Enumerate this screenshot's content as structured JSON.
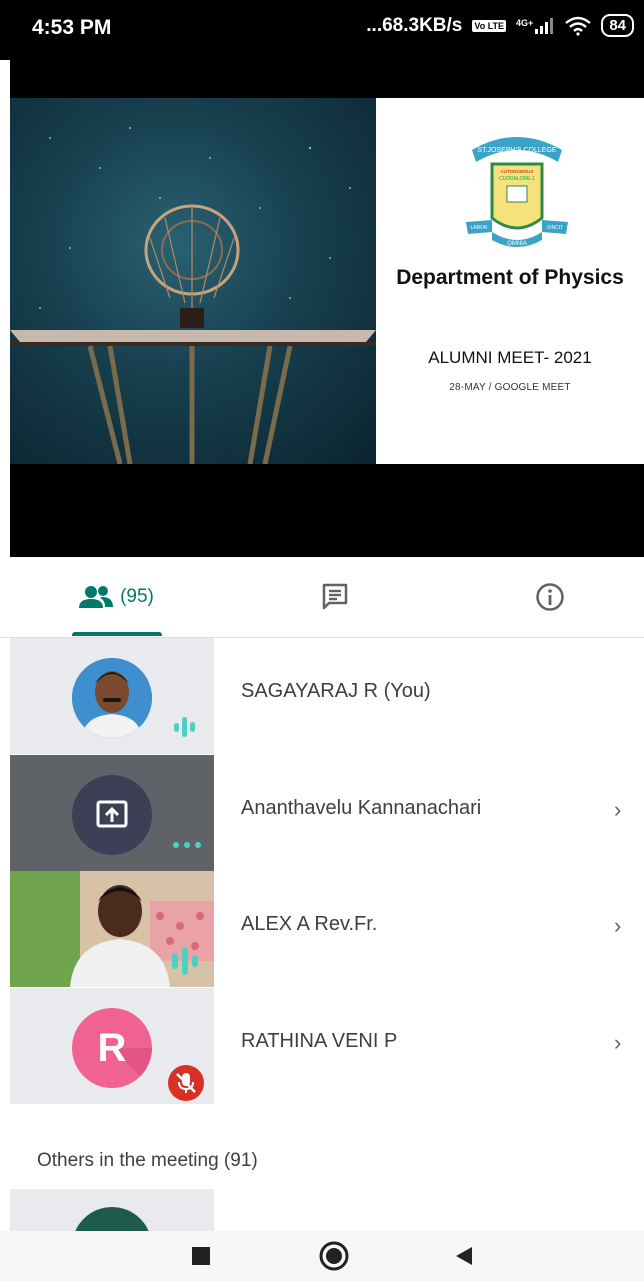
{
  "status": {
    "time": "4:53 PM",
    "net_speed": "...68.3KB/s",
    "volte": "Vo LTE",
    "network": "4G+",
    "battery": "84"
  },
  "presentation": {
    "college_crest_text": [
      "ST.JOSEPH'S COLLEGE",
      "AUTONOMOUS",
      "CUDDALORE-1",
      "LABOR",
      "OMNIA",
      "VINCIT"
    ],
    "department": "Department of Physics",
    "event": "ALUMNI MEET- 2021",
    "event_sub": "28-MAY / GOOGLE MEET"
  },
  "tabs": {
    "people_count": "(95)",
    "people_icon": "people-icon",
    "chat_icon": "chat-icon",
    "info_icon": "info-icon"
  },
  "participants": [
    {
      "name": "SAGAYARAJ R (You)",
      "status_icon": "speaking-icon"
    },
    {
      "name": "Ananthavelu Kannanachari",
      "status_icon": "more-dots-icon",
      "thumb_icon": "present-screen-icon"
    },
    {
      "name": "ALEX A Rev.Fr.",
      "status_icon": "speaking-icon"
    },
    {
      "name": "RATHINA VENI P",
      "avatar_letter": "R",
      "status_icon": "mic-off-icon"
    }
  ],
  "chevron": "›",
  "others_section": "Others in the meeting (91)",
  "colors": {
    "accent": "#00796b",
    "speaking": "#4dd0c4",
    "muted": "#d93025",
    "avatar_pink": "#f06292"
  }
}
